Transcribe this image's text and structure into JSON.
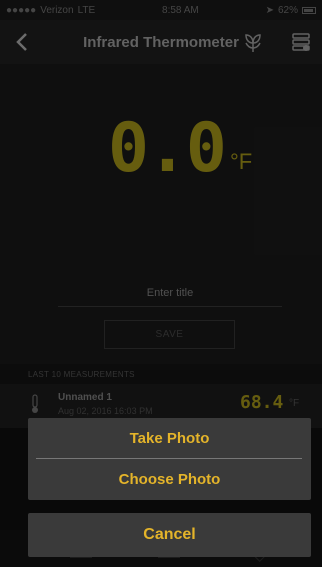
{
  "statusbar": {
    "signal": "●●●●●",
    "carrier": "Verizon",
    "network": "LTE",
    "time": "8:58 AM",
    "battery_pct": "62%"
  },
  "nav": {
    "title": "Infrared Thermometer",
    "back_icon": "back-chevron-icon",
    "leaf_icon": "leaf-icon",
    "db_icon": "database-icon"
  },
  "reading": {
    "value": "0.0",
    "unit": "°F"
  },
  "form": {
    "title_placeholder": "Enter title",
    "save_label": "SAVE"
  },
  "measurements": {
    "header": "LAST 10 MEASUREMENTS",
    "items": [
      {
        "name": "Unnamed 1",
        "date": "Aug 02, 2016 16:03 PM",
        "value": "68.4",
        "unit": "°F"
      }
    ]
  },
  "action_sheet": {
    "take_photo": "Take Photo",
    "choose_photo": "Choose Photo",
    "cancel": "Cancel"
  },
  "colors": {
    "accent": "#b0a11a",
    "sheet_text": "#e4b42a",
    "sheet_bg": "#3a3a3a"
  }
}
